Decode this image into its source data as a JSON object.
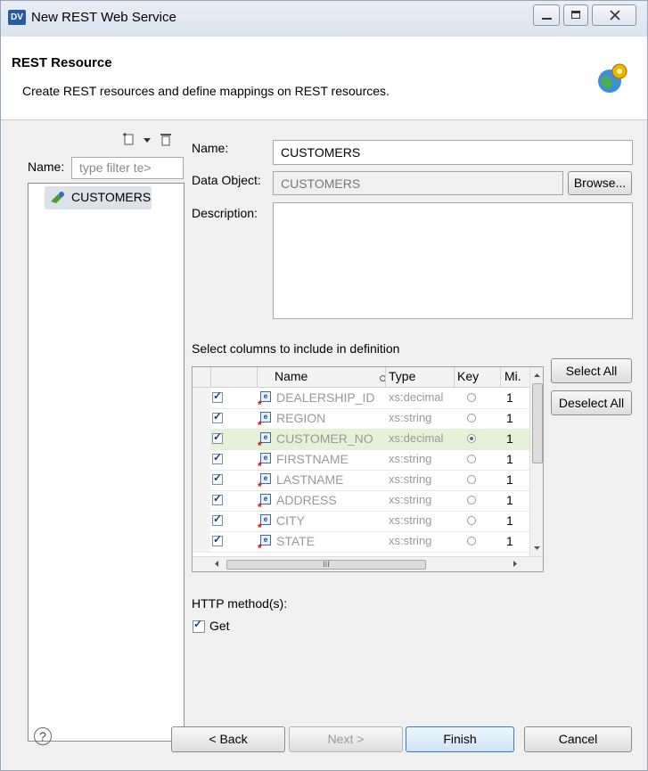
{
  "window": {
    "title": "New REST Web Service",
    "app_icon": "DV"
  },
  "header": {
    "title": "REST Resource",
    "description": "Create REST resources and define mappings on REST resources."
  },
  "tree": {
    "filter_label": "Name:",
    "filter_placeholder": "type filter te>",
    "items": [
      {
        "label": "CUSTOMERS"
      }
    ]
  },
  "form": {
    "name_label": "Name:",
    "name_value": "CUSTOMERS",
    "data_object_label": "Data Object:",
    "data_object_value": "CUSTOMERS",
    "browse_label": "Browse...",
    "description_label": "Description:",
    "description_value": ""
  },
  "columns": {
    "section_label": "Select columns to include in definition",
    "headers": {
      "name": "Name",
      "type": "Type",
      "key": "Key",
      "min": "Mi."
    },
    "rows": [
      {
        "name": "DEALERSHIP_ID",
        "type": "xs:decimal",
        "key": false,
        "min": "1",
        "checked": true
      },
      {
        "name": "REGION",
        "type": "xs:string",
        "key": false,
        "min": "1",
        "checked": true
      },
      {
        "name": "CUSTOMER_NO",
        "type": "xs:decimal",
        "key": true,
        "min": "1",
        "checked": true
      },
      {
        "name": "FIRSTNAME",
        "type": "xs:string",
        "key": false,
        "min": "1",
        "checked": true
      },
      {
        "name": "LASTNAME",
        "type": "xs:string",
        "key": false,
        "min": "1",
        "checked": true
      },
      {
        "name": "ADDRESS",
        "type": "xs:string",
        "key": false,
        "min": "1",
        "checked": true
      },
      {
        "name": "CITY",
        "type": "xs:string",
        "key": false,
        "min": "1",
        "checked": true
      },
      {
        "name": "STATE",
        "type": "xs:string",
        "key": false,
        "min": "1",
        "checked": true
      }
    ],
    "select_all_label": "Select All",
    "deselect_all_label": "Deselect All",
    "hscroll_grip": "III"
  },
  "http": {
    "label": "HTTP method(s):",
    "get_label": "Get",
    "get_checked": true
  },
  "footer": {
    "help": "?",
    "back": "< Back",
    "next": "Next >",
    "finish": "Finish",
    "cancel": "Cancel"
  },
  "colors": {
    "highlight_row": "#e4f2d5",
    "accent": "#3b7bc4"
  }
}
